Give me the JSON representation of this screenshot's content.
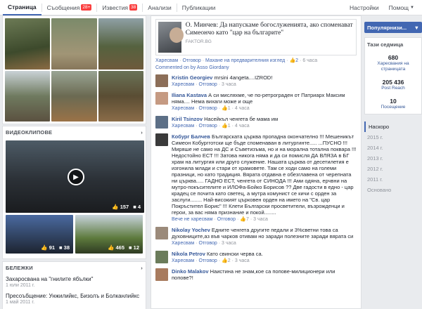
{
  "nav": {
    "tabs": [
      {
        "label": "Страница",
        "badge": ""
      },
      {
        "label": "Съобщения",
        "badge": "28+"
      },
      {
        "label": "Известия",
        "badge": "38"
      },
      {
        "label": "Анализи",
        "badge": ""
      },
      {
        "label": "Публикации",
        "badge": ""
      }
    ],
    "settings": "Настройки",
    "help": "Помощ"
  },
  "videos": {
    "title": "Видеоклипове",
    "main_likes": "157",
    "main_comments": "4",
    "small": [
      {
        "likes": "91",
        "comments": "38"
      },
      {
        "likes": "465",
        "comments": "12"
      }
    ]
  },
  "notes": {
    "title": "Бележки",
    "items": [
      {
        "title": "Захаросвана на \"гнилите ябълки\"",
        "date": "1 юли 2011 г."
      },
      {
        "title": "Пресоъбщение: Унжилийкс, Бизолъ и Болканлийкс",
        "date": "1 май 2011 г."
      }
    ]
  },
  "post": {
    "headline": "О. Минчев: Да напускаме богослуженията, ако споменават Симеончо като \"цар на българите\"",
    "source": "FAKTOR.BG",
    "like": "Харесвам",
    "reply": "Отговор",
    "remove_preview": "Махане на предварителния изглед",
    "likes": "2",
    "time": "6 часа",
    "commented_by": "Commented on by Asso Giordany"
  },
  "comments": [
    {
      "name": "Kristin Georgiev",
      "text": "mrsini 4angeta....IZROD!",
      "likes": "",
      "time": "3 часа"
    },
    {
      "name": "Iliana Kastava",
      "text": "А си мисляхме, че по-ретрограден от Патриарх Максим няма.... Нема вихаги може и още",
      "likes": "1",
      "time": "4 часа"
    },
    {
      "name": "Kiril Tsinzov",
      "text": "Насейкъл ченгета бе мама им",
      "likes": "1",
      "time": "4 часа"
    },
    {
      "name": "Кобург Балчев",
      "text": "Българската църква пропадна окончателно !!! Мешеникът Симеон Кобургготски ще бъде споменаван в литургинте..... ...ПУСНО !!! Миряше не само на ДС и Съветизъма, но и на морална тотална поквара !!! Недостойно ЕСТ !!! Затова никога няма и да си помисля ДА ВЛЯЗА в БГ храм на литургия или друго служение. Нашата църква от десетилетия е изгонила млади и стари от храмовете. Там се ходи само на големи празници, но като традиция. Вярата отдавна е обезглавена от черепната ни църква..... ГАДНО ЕСТ, ченгета от СИНОДА !!! Ами одяна, ерчвни на мутро-покъсителите и ИЛОФа-Бойко Борисов ?? Две гадости в едно - цар крадец се почита като светец, а мутра комунист се кичи с орден за заслуги........ Най-високият църковен орден на името на \"Св. цар Покръстител Борис\" !!! Клети Български просветители, възрожденци и герои, за вас няма признание и покой........",
      "likes": "",
      "time": "",
      "more": "Вече не харесвам",
      "more_likes": "7",
      "more_time": "3 часа"
    },
    {
      "name": "Nikolay Yochev",
      "text": "Едните ченгета другите педали и 3%светни това са духовниците,аз във чарков отивам но заради полезните заради вярата си",
      "likes": "",
      "time": "3 часа"
    },
    {
      "name": "Nikola Petrov",
      "text": "Като свински черва са.",
      "likes": "2",
      "time": "3 часа"
    },
    {
      "name": "Dinko Malakov",
      "text": "Наистина не знам,кое са попове-милиционери или попове?!",
      "likes": "",
      "time": ""
    }
  ],
  "sidebar": {
    "popular": "Популярнизи...",
    "week_title": "Тази седмица",
    "stats": [
      {
        "value": "680",
        "label": "Харесвания на страницата"
      },
      {
        "value": "205 436",
        "label": "Post Reach"
      },
      {
        "value": "10",
        "label": "Посещение"
      }
    ],
    "years": [
      "Наскоро",
      "2015 г.",
      "2014 г.",
      "2013 г.",
      "2012 г.",
      "2011 г.",
      "Основано"
    ]
  }
}
